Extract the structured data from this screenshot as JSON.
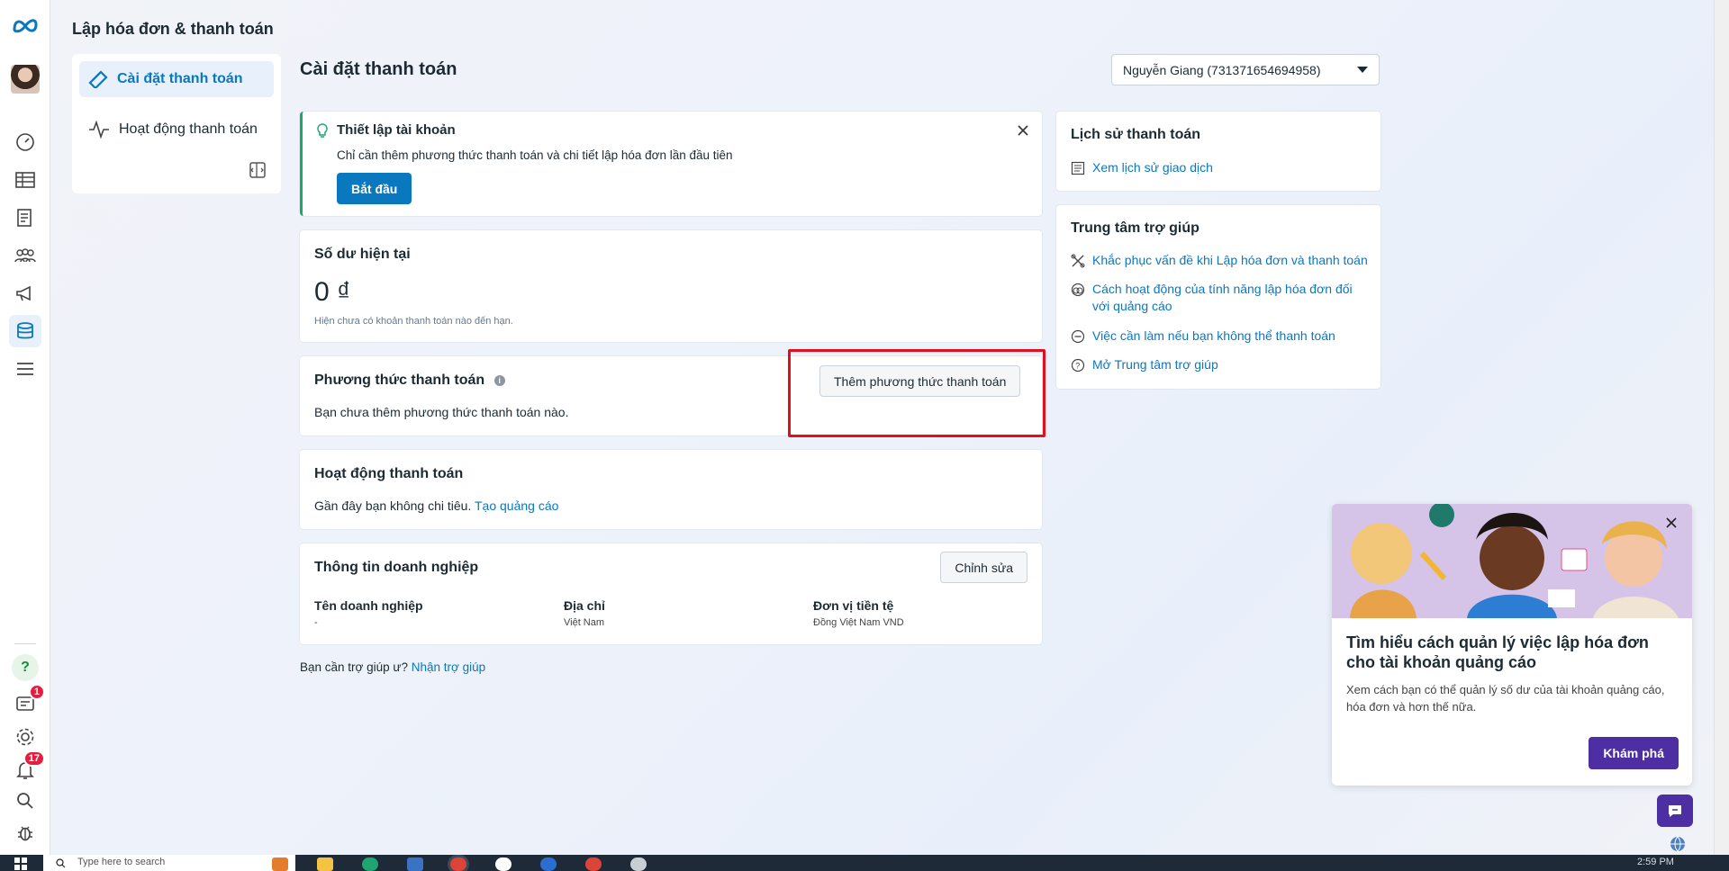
{
  "app": {
    "title": "Lập hóa đơn & thanh toán"
  },
  "rail": {
    "notification_count": "1",
    "alerts_count": "17"
  },
  "nav": {
    "items": [
      {
        "label": "Cài đặt thanh toán",
        "active": true
      },
      {
        "label": "Hoạt động thanh toán",
        "active": false
      }
    ]
  },
  "page": {
    "title": "Cài đặt thanh toán",
    "account_selector": "Nguyễn Giang (731371654694958)"
  },
  "setup": {
    "title": "Thiết lập tài khoản",
    "description": "Chỉ cần thêm phương thức thanh toán và chi tiết lập hóa đơn lần đầu tiên",
    "button": "Bắt đầu"
  },
  "balance": {
    "title": "Số dư hiện tại",
    "amount": "0",
    "currency_symbol": "₫",
    "note": "Hiện chưa có khoản thanh toán nào đến hạn."
  },
  "payment_method": {
    "title": "Phương thức thanh toán",
    "empty_text": "Bạn chưa thêm phương thức thanh toán nào.",
    "add_button": "Thêm phương thức thanh toán"
  },
  "payment_activity": {
    "title": "Hoạt động thanh toán",
    "text": "Gần đây bạn không chi tiêu.",
    "link": "Tạo quảng cáo"
  },
  "business_info": {
    "title": "Thông tin doanh nghiệp",
    "edit_button": "Chỉnh sửa",
    "fields": [
      {
        "label": "Tên doanh nghiệp",
        "value": "-"
      },
      {
        "label": "Địa chỉ",
        "value": "Việt Nam"
      },
      {
        "label": "Đơn vị tiền tệ",
        "value": "Đồng Việt Nam VND"
      }
    ]
  },
  "help_footer": {
    "text": "Bạn cần trợ giúp ư?",
    "link": "Nhận trợ giúp"
  },
  "payment_history": {
    "title": "Lịch sử thanh toán",
    "link": "Xem lịch sử giao dịch"
  },
  "help_center": {
    "title": "Trung tâm trợ giúp",
    "links": [
      "Khắc phục vấn đề khi Lập hóa đơn và thanh toán",
      "Cách hoạt động của tính năng lập hóa đơn đối với quảng cáo",
      "Việc cần làm nếu bạn không thể thanh toán",
      "Mở Trung tâm trợ giúp"
    ]
  },
  "promo": {
    "title": "Tìm hiểu cách quản lý việc lập hóa đơn cho tài khoản quảng cáo",
    "description": "Xem cách bạn có thể quản lý số dư của tài khoản quảng cáo, hóa đơn và hơn thế nữa.",
    "button": "Khám phá"
  },
  "taskbar": {
    "search_placeholder": "Type here to search",
    "clock": "2:59 PM"
  },
  "colors": {
    "primary": "#0a78be",
    "promo_button": "#4e2fa3",
    "highlight": "#e0101f",
    "badge": "#e41e3f"
  }
}
